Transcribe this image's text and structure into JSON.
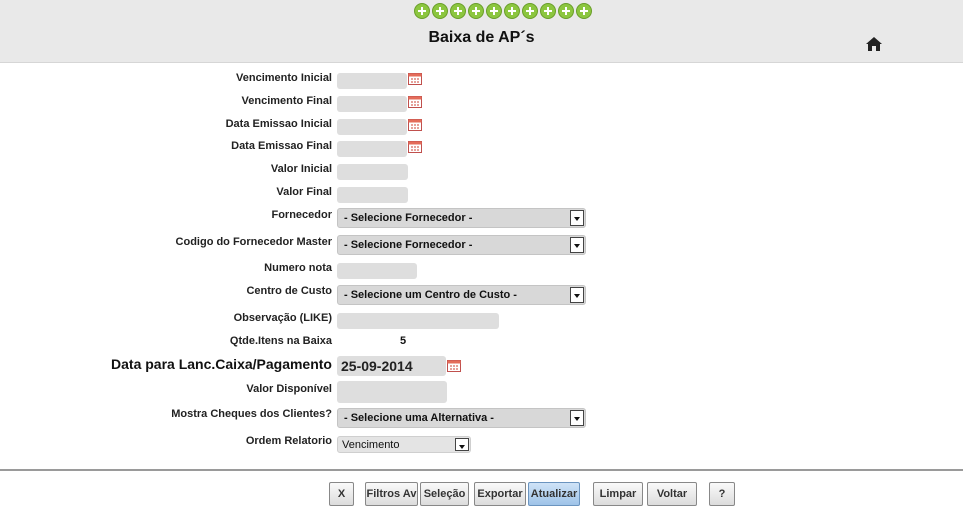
{
  "header": {
    "title": "Baixa de AP´s",
    "quick_add_icons": [
      "plus-icon",
      "plus-icon",
      "plus-icon",
      "plus-icon",
      "plus-icon",
      "plus-icon",
      "plus-icon",
      "plus-icon",
      "plus-icon",
      "plus-icon"
    ],
    "home_icon": "home-icon",
    "accent_green": "#8cc63f"
  },
  "form": {
    "vencimento_inicial": {
      "label": "Vencimento Inicial",
      "value": ""
    },
    "vencimento_final": {
      "label": "Vencimento Final",
      "value": ""
    },
    "data_emissao_inicial": {
      "label": "Data Emissao Inicial",
      "value": ""
    },
    "data_emissao_final": {
      "label": "Data Emissao Final",
      "value": ""
    },
    "valor_inicial": {
      "label": "Valor Inicial",
      "value": ""
    },
    "valor_final": {
      "label": "Valor Final",
      "value": ""
    },
    "fornecedor": {
      "label": "Fornecedor",
      "selected": "- Selecione Fornecedor -"
    },
    "codigo_fornecedor_master": {
      "label": "Codigo do Fornecedor Master",
      "selected": "- Selecione Fornecedor -"
    },
    "numero_nota": {
      "label": "Numero nota",
      "value": ""
    },
    "centro_custo": {
      "label": "Centro de Custo",
      "selected": "- Selecione um Centro de Custo -"
    },
    "observacao": {
      "label": "Observação (LIKE)",
      "value": ""
    },
    "qtde_itens": {
      "label": "Qtde.Itens na Baixa",
      "value": "5"
    },
    "data_lanc": {
      "label": "Data para Lanc.Caixa/Pagamento",
      "value": "25-09-2014"
    },
    "valor_disponivel": {
      "label": "Valor Disponível",
      "value": ""
    },
    "mostra_cheques": {
      "label": "Mostra Cheques dos Clientes?",
      "selected": "- Selecione uma Alternativa -"
    },
    "ordem_relatorio": {
      "label": "Ordem Relatorio",
      "selected": "Vencimento"
    }
  },
  "toolbar": {
    "close_label": "X",
    "filtros_label": "Filtros Av",
    "selecao_label": "Seleção",
    "exportar_label": "Exportar",
    "atualizar_label": "Atualizar",
    "limpar_label": "Limpar",
    "voltar_label": "Voltar",
    "help_label": "?"
  }
}
